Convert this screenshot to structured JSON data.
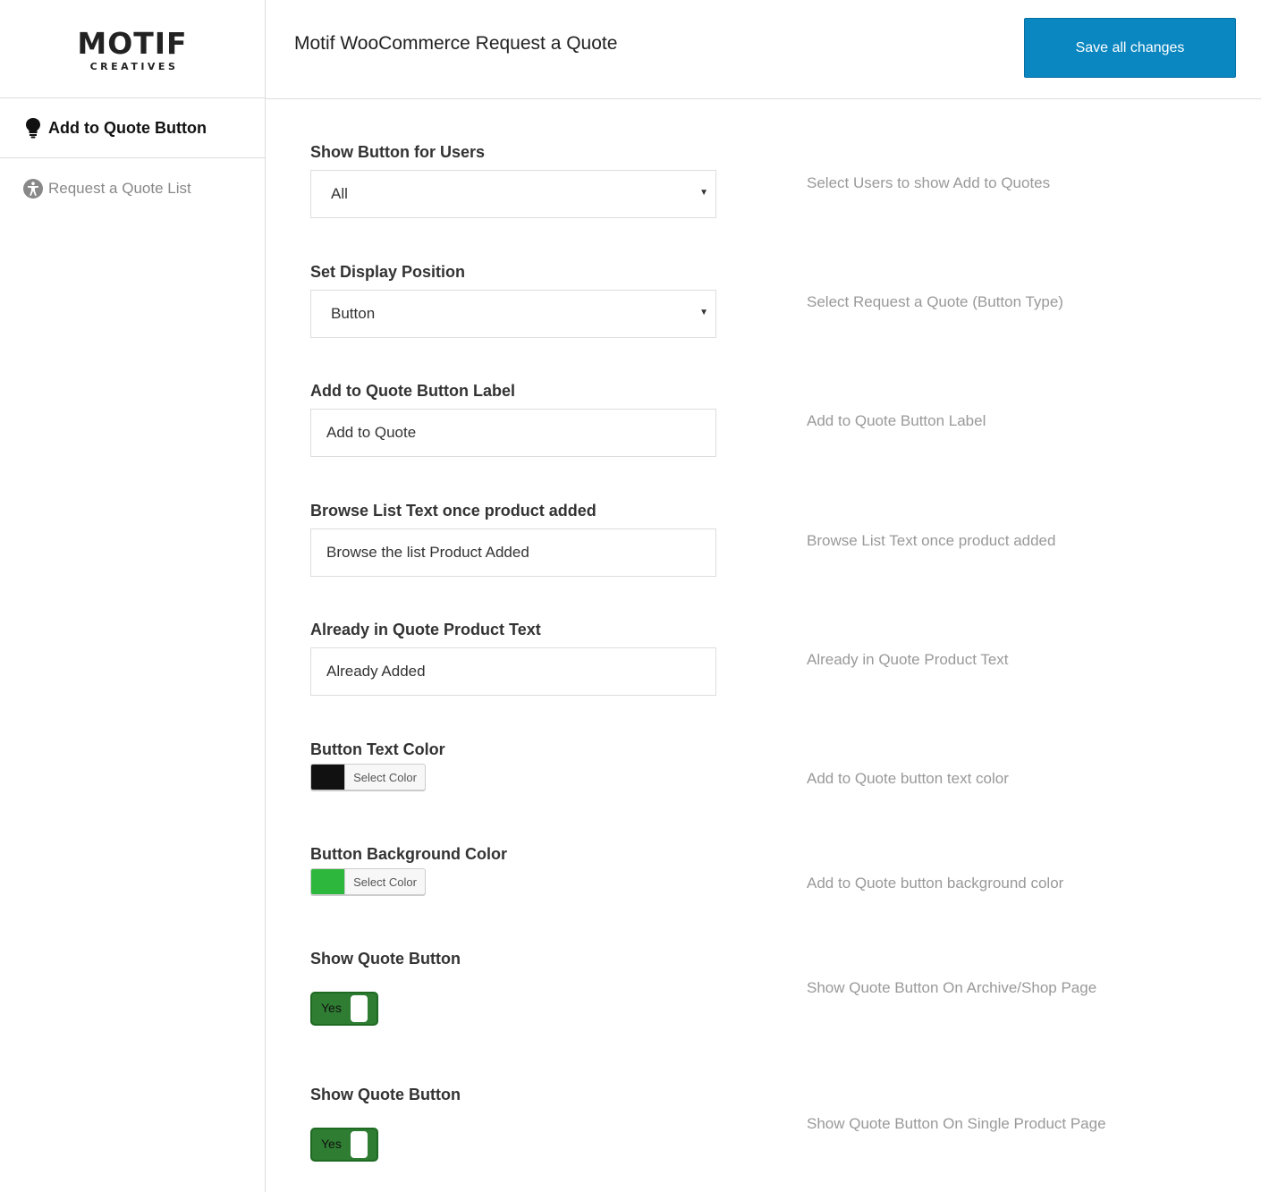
{
  "logo": {
    "main": "MOTIF",
    "sub": "CREATIVES"
  },
  "sidebar": {
    "items": [
      {
        "label": "Add to Quote Button",
        "icon": "lightbulb-icon"
      },
      {
        "label": "Request a Quote List",
        "icon": "accessibility-icon"
      }
    ]
  },
  "header": {
    "title": "Motif WooCommerce Request a Quote",
    "save_label": "Save all changes"
  },
  "fields": {
    "show_users": {
      "label": "Show Button for Users",
      "value": "All",
      "desc": "Select Users to show Add to Quotes"
    },
    "display_position": {
      "label": "Set Display Position",
      "value": "Button",
      "desc": "Select Request a Quote (Button Type)"
    },
    "button_label": {
      "label": "Add to Quote Button Label",
      "value": "Add to Quote",
      "desc": "Add to Quote Button Label"
    },
    "browse_text": {
      "label": "Browse List Text once product added",
      "value": "Browse the list Product Added",
      "desc": "Browse List Text once product added"
    },
    "already_text": {
      "label": "Already in Quote Product Text",
      "value": "Already Added",
      "desc": "Already in Quote Product Text"
    },
    "text_color": {
      "label": "Button Text Color",
      "button": "Select Color",
      "color": "#111111",
      "desc": "Add to Quote button text color"
    },
    "bg_color": {
      "label": "Button Background Color",
      "button": "Select Color",
      "color": "#2db83d",
      "desc": "Add to Quote button background color"
    },
    "show_archive": {
      "label": "Show Quote Button",
      "toggle": "Yes",
      "desc": "Show Quote Button On Archive/Shop Page"
    },
    "show_single": {
      "label": "Show Quote Button",
      "toggle": "Yes",
      "desc": "Show Quote Button On Single Product Page"
    }
  }
}
